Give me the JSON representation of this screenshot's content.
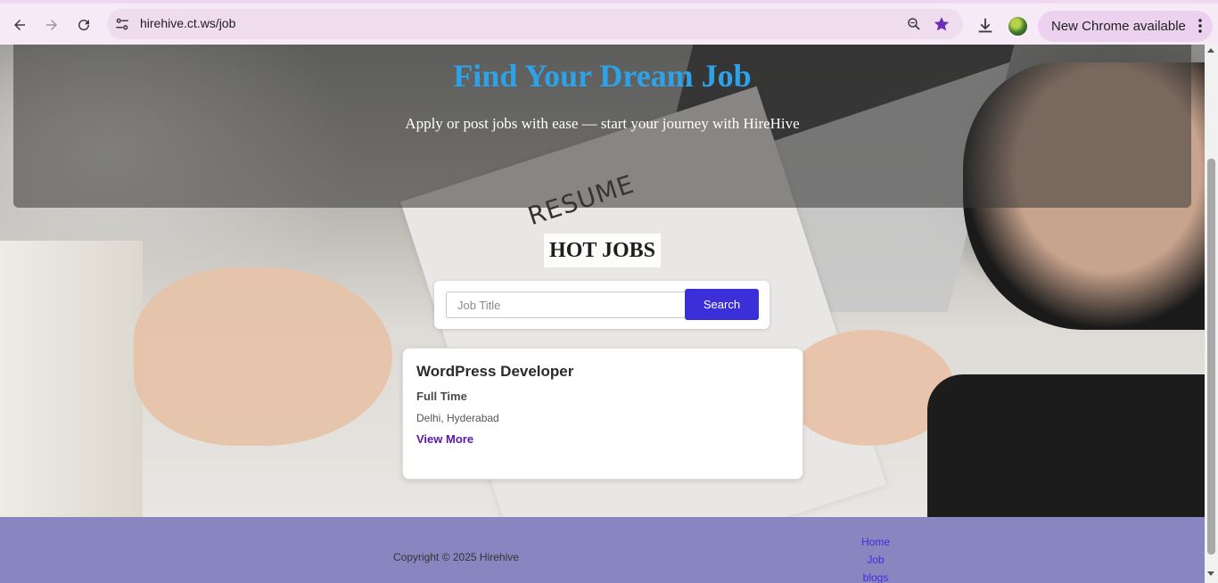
{
  "browser": {
    "url": "hirehive.ct.ws/job",
    "new_chrome_label": "New Chrome available",
    "icons": [
      "back-icon",
      "forward-icon",
      "reload-icon",
      "site-info-icon",
      "zoom-icon",
      "bookmark-star-icon",
      "download-icon",
      "profile-avatar",
      "more-vert-icon"
    ],
    "star_color": "#6b2fb3"
  },
  "hero": {
    "title": "Find Your Dream Job",
    "subtitle": "Apply or post jobs with ease — start your journey with HireHive",
    "title_color": "#2ea2e8",
    "image_text": "RESUME"
  },
  "hot_jobs": {
    "heading": "HOT JOBS"
  },
  "search": {
    "placeholder": "Job Title",
    "value": "",
    "button_label": "Search",
    "button_color": "#3b2fd9"
  },
  "jobs": [
    {
      "title": "WordPress Developer",
      "type": "Full Time",
      "location": "Delhi, Hyderabad",
      "link_label": "View More"
    }
  ],
  "footer": {
    "copyright": "Copyright © 2025 Hirehive",
    "links": [
      "Home",
      "Job",
      "blogs"
    ],
    "background": "#8985c1"
  }
}
